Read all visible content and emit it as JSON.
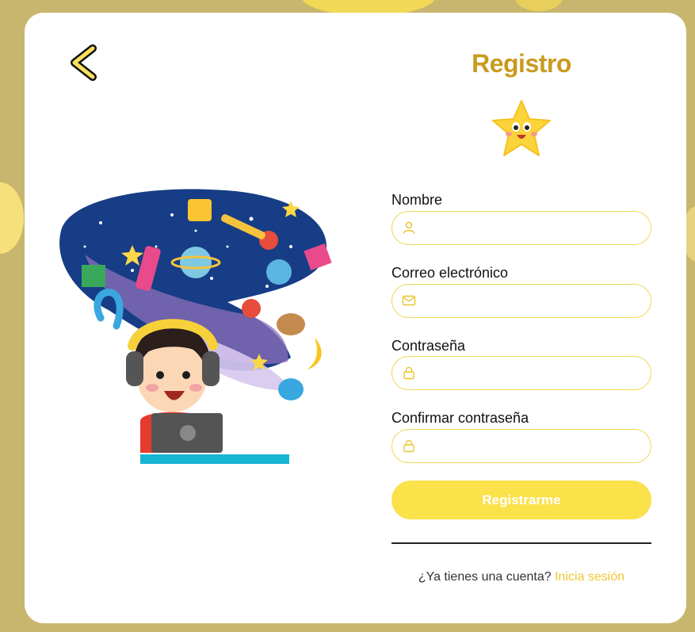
{
  "header": {
    "title": "Registro"
  },
  "form": {
    "fields": [
      {
        "label": "Nombre",
        "icon": "user-icon",
        "value": "",
        "placeholder": ""
      },
      {
        "label": "Correo electrónico",
        "icon": "mail-icon",
        "value": "",
        "placeholder": ""
      },
      {
        "label": "Contraseña",
        "icon": "lock-icon",
        "value": "",
        "placeholder": ""
      },
      {
        "label": "Confirmar contraseña",
        "icon": "lock-icon",
        "value": "",
        "placeholder": ""
      }
    ],
    "submit_label": "Registrarme"
  },
  "footer": {
    "question": "¿Ya tienes una cuenta?",
    "link_label": "Inicia sesión"
  },
  "colors": {
    "accent": "#fbe14a",
    "title": "#c99a1f",
    "link": "#f1c733",
    "field_border": "#f0d65a",
    "background": "#c9b66e"
  }
}
